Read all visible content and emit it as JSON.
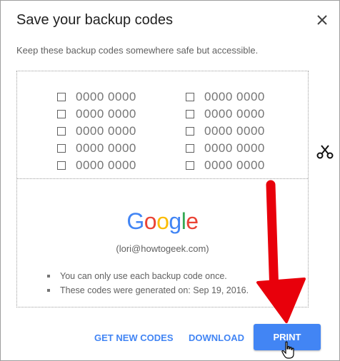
{
  "dialog": {
    "title": "Save your backup codes",
    "subtitle": "Keep these backup codes somewhere safe but accessible.",
    "close_icon": "close-icon"
  },
  "codes": {
    "left": [
      "0000 0000",
      "0000 0000",
      "0000 0000",
      "0000 0000",
      "0000 0000"
    ],
    "right": [
      "0000 0000",
      "0000 0000",
      "0000 0000",
      "0000 0000",
      "0000 0000"
    ]
  },
  "scissors_icon": "scissors-icon",
  "account": {
    "logo_text": "Google",
    "email": "(lori@howtogeek.com)"
  },
  "notes": [
    "You can only use each backup code once.",
    "These codes were generated on: Sep 19, 2016."
  ],
  "buttons": {
    "get_new_codes": "GET NEW CODES",
    "download": "DOWNLOAD",
    "print": "PRINT"
  },
  "colors": {
    "accent": "#4285f4",
    "arrow": "#e8000b"
  }
}
